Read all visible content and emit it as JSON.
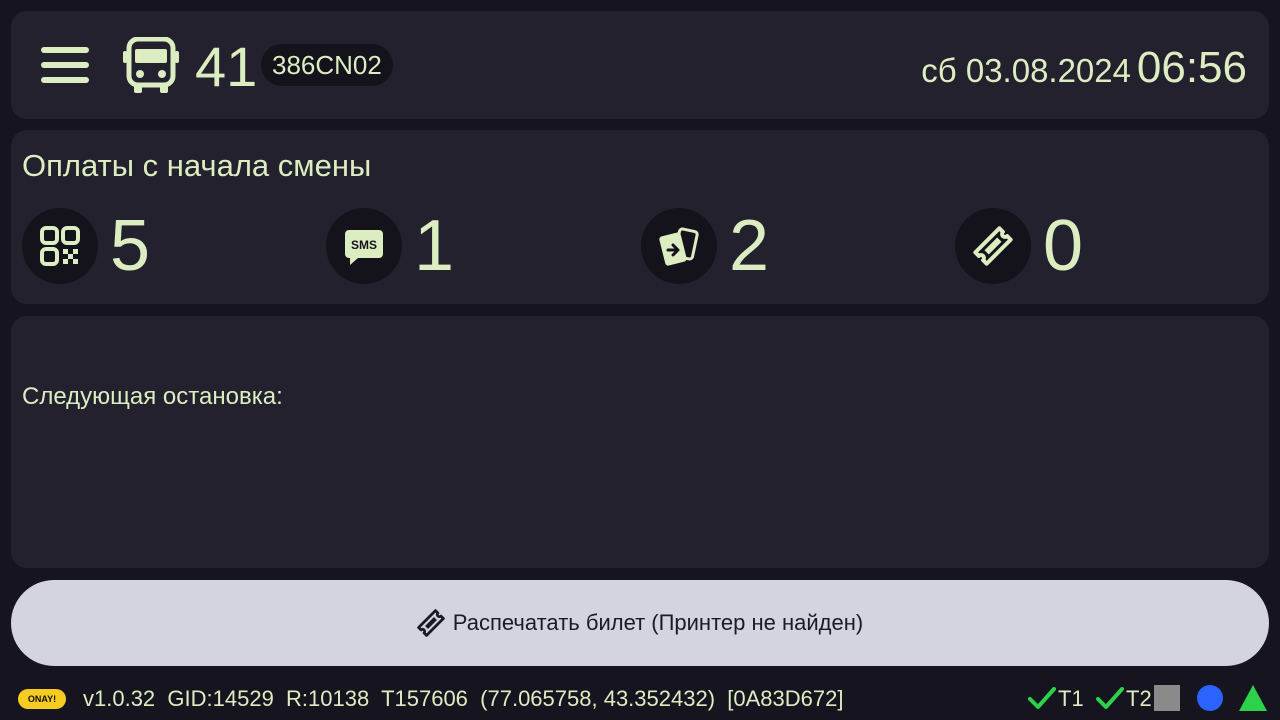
{
  "header": {
    "menu_icon": "hamburger-menu-icon",
    "bus_icon": "bus-icon",
    "route_number": "41",
    "vehicle_plate": "386CN02",
    "date": "сб 03.08.2024",
    "time": "06:56"
  },
  "payments": {
    "title": "Оплаты с начала смены",
    "items": [
      {
        "icon": "qr-code-icon",
        "count": "5"
      },
      {
        "icon": "sms-icon",
        "count": "1"
      },
      {
        "icon": "card-payment-icon",
        "count": "2"
      },
      {
        "icon": "ticket-icon",
        "count": "0"
      }
    ]
  },
  "next_stop": {
    "label": "Следующая остановка:"
  },
  "print_button": {
    "icon": "ticket-icon",
    "label": "Распечатать билет (Принтер не найден)"
  },
  "status_bar": {
    "brand": "ONAY!",
    "version": "v1.0.32",
    "gid": "GID:14529",
    "r": "R:10138",
    "t": "T157606",
    "coords": "(77.065758, 43.352432)",
    "device_id": "[0A83D672]",
    "indicator_t1": "T1",
    "indicator_t2": "T2",
    "colors": {
      "check": "#2bd24a",
      "square": "#8a8a8a",
      "circle": "#2c63ff",
      "triangle": "#2bd24a"
    }
  },
  "colors": {
    "background": "#16151f",
    "panel": "#22212d",
    "accent_text": "#dcedc1",
    "button_bg": "#d3d4dd"
  }
}
